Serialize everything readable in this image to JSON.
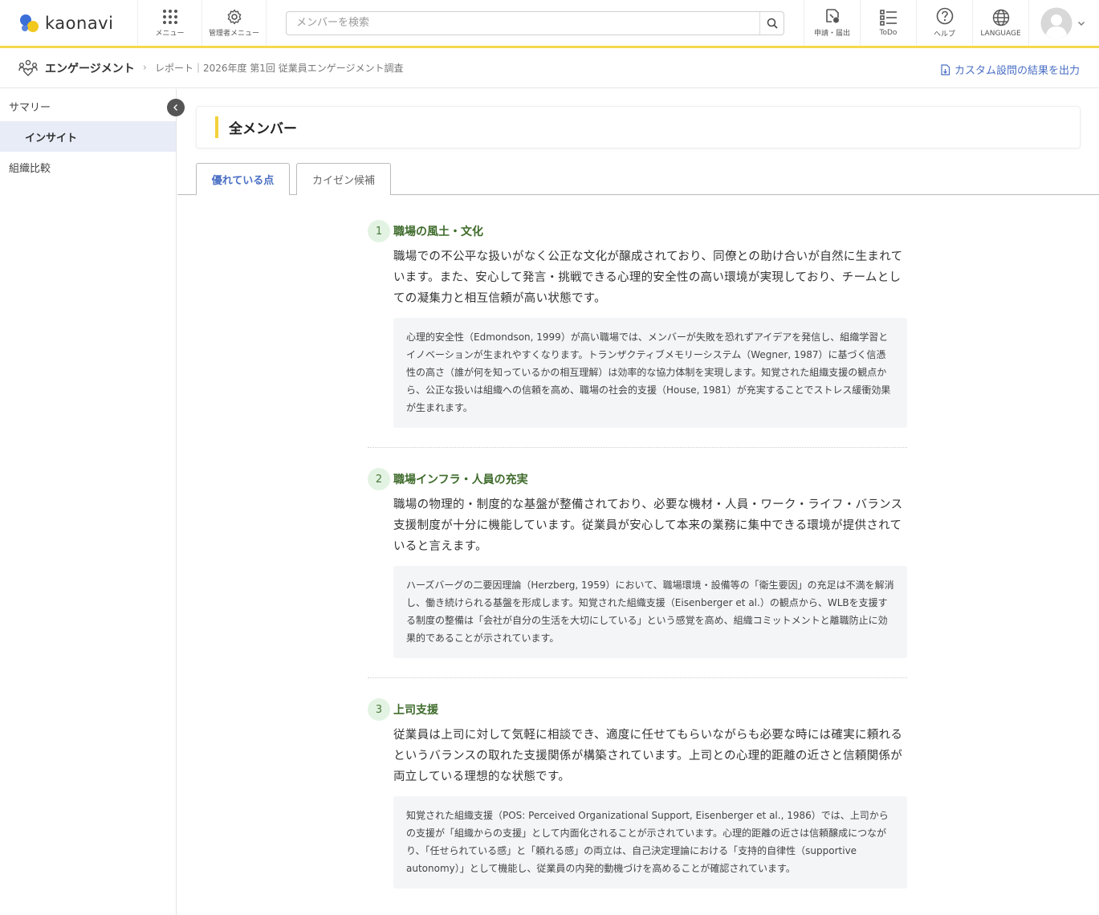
{
  "header": {
    "logo_text": "kaonavi",
    "menu_label": "メニュー",
    "admin_menu_label": "管理者メニュー",
    "search_placeholder": "メンバーを検索",
    "apply_label": "申請・届出",
    "todo_label": "ToDo",
    "help_label": "ヘルプ",
    "language_label": "LANGUAGE"
  },
  "subheader": {
    "app_name": "エンゲージメント",
    "breadcrumb": "レポート｜2026年度 第1回 従業員エンゲージメント調査",
    "export_label": "カスタム設問の結果を出力"
  },
  "sidebar": {
    "items": [
      {
        "label": "サマリー"
      },
      {
        "label": "インサイト"
      },
      {
        "label": "組織比較"
      }
    ]
  },
  "main": {
    "title": "全メンバー",
    "tabs": [
      {
        "label": "優れている点"
      },
      {
        "label": "カイゼン候補"
      }
    ],
    "sections": [
      {
        "number": "1",
        "title": "職場の風土・文化",
        "body": "職場での不公平な扱いがなく公正な文化が醸成されており、同僚との助け合いが自然に生まれています。また、安心して発言・挑戦できる心理的安全性の高い環境が実現しており、チームとしての凝集力と相互信頼が高い状態です。",
        "note": "心理的安全性（Edmondson, 1999）が高い職場では、メンバーが失敗を恐れずアイデアを発信し、組織学習とイノベーションが生まれやすくなります。トランザクティブメモリーシステム（Wegner, 1987）に基づく信憑性の高さ（誰が何を知っているかの相互理解）は効率的な協力体制を実現します。知覚された組織支援の観点から、公正な扱いは組織への信頼を高め、職場の社会的支援（House, 1981）が充実することでストレス緩衝効果が生まれます。"
      },
      {
        "number": "2",
        "title": "職場インフラ・人員の充実",
        "body": "職場の物理的・制度的な基盤が整備されており、必要な機材・人員・ワーク・ライフ・バランス支援制度が十分に機能しています。従業員が安心して本来の業務に集中できる環境が提供されていると言えます。",
        "note": "ハーズバーグの二要因理論（Herzberg, 1959）において、職場環境・設備等の「衛生要因」の充足は不満を解消し、働き続けられる基盤を形成します。知覚された組織支援（Eisenberger et al.）の観点から、WLBを支援する制度の整備は「会社が自分の生活を大切にしている」という感覚を高め、組織コミットメントと離職防止に効果的であることが示されています。"
      },
      {
        "number": "3",
        "title": "上司支援",
        "body": "従業員は上司に対して気軽に相談でき、適度に任せてもらいながらも必要な時には確実に頼れるというバランスの取れた支援関係が構築されています。上司との心理的距離の近さと信頼関係が両立している理想的な状態です。",
        "note": "知覚された組織支援（POS: Perceived Organizational Support, Eisenberger et al., 1986）では、上司からの支援が「組織からの支援」として内面化されることが示されています。心理的距離の近さは信頼醸成につながり、「任せられている感」と「頼れる感」の両立は、自己決定理論における「支持的自律性（supportive autonomy）」として機能し、従業員の内発的動機づけを高めることが確認されています。"
      }
    ]
  }
}
